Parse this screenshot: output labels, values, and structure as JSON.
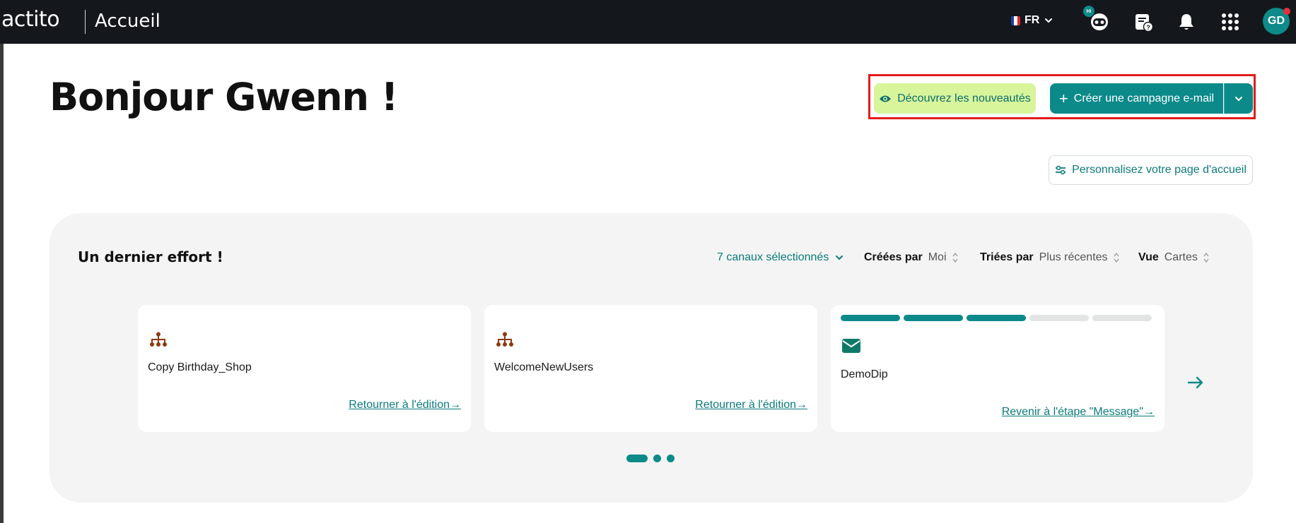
{
  "header": {
    "logo": "actito",
    "page_title": "Accueil",
    "language": "FR",
    "bot_badge": "Hi",
    "avatar_initials": "GD"
  },
  "hero": {
    "greeting": "Bonjour Gwenn !",
    "news_button": "Découvrez les nouveautés",
    "create_button": "Créer une campagne e-mail",
    "personalize_button": "Personnalisez votre page d'accueil"
  },
  "panel": {
    "title": "Un dernier effort !",
    "channels_filter": "7 canaux sélectionnés",
    "created_by_label": "Créées par",
    "created_by_value": "Moi",
    "sorted_by_label": "Triées par",
    "sorted_by_value": "Plus récentes",
    "view_label": "Vue",
    "view_value": "Cartes",
    "cards": [
      {
        "icon": "workflow-icon",
        "name": "Copy Birthday_Shop",
        "link": "Retourner à l'édition"
      },
      {
        "icon": "workflow-icon",
        "name": "WelcomeNewUsers",
        "link": "Retourner à l'édition"
      },
      {
        "icon": "email-icon",
        "name": "DemoDip",
        "link": "Revenir à l'étape \"Message\"",
        "steps_completed": 3,
        "steps_total": 5
      }
    ],
    "pagination": {
      "pages": 3,
      "current": 1
    }
  },
  "colors": {
    "topbar": "#14181c",
    "accent": "#0c8a8a",
    "news_button_bg": "#d8f59b",
    "workflow_icon": "#8b3b0e",
    "highlight_border": "#e21b1b",
    "panel_bg": "#f3f4f3"
  }
}
